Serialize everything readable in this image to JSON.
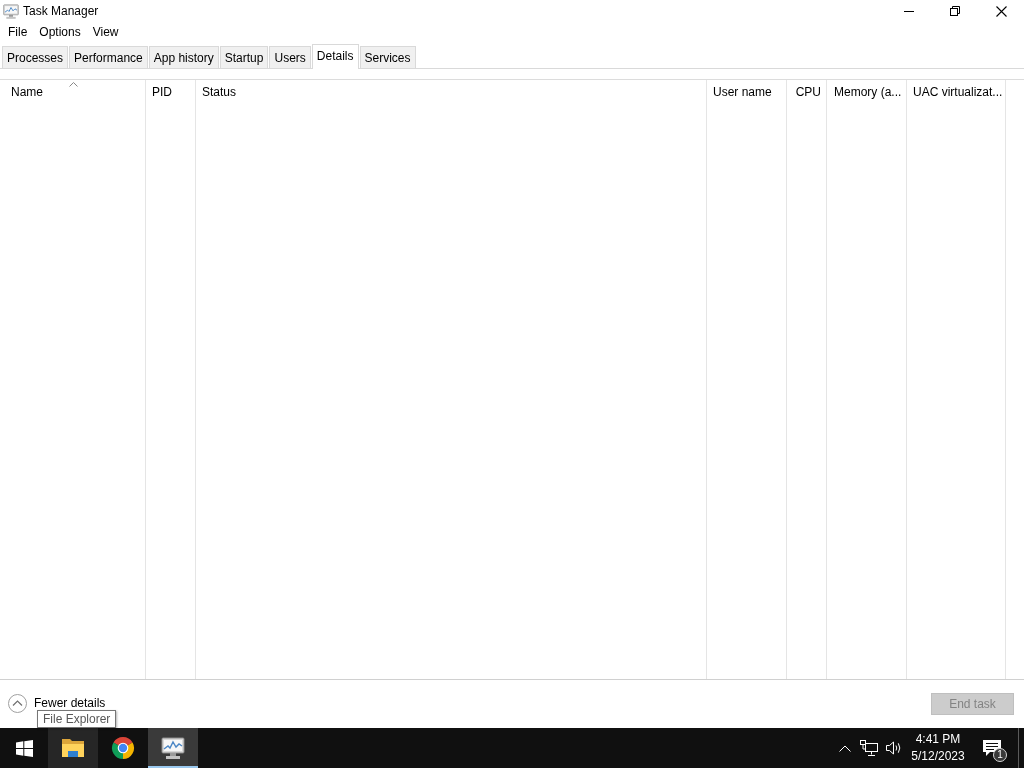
{
  "window": {
    "title": "Task Manager"
  },
  "menu": [
    "File",
    "Options",
    "View"
  ],
  "tabs": [
    {
      "label": "Processes",
      "selected": false
    },
    {
      "label": "Performance",
      "selected": false
    },
    {
      "label": "App history",
      "selected": false
    },
    {
      "label": "Startup",
      "selected": false
    },
    {
      "label": "Users",
      "selected": false
    },
    {
      "label": "Details",
      "selected": true
    },
    {
      "label": "Services",
      "selected": false
    }
  ],
  "table": {
    "columns": [
      {
        "label": "Name",
        "sorted": true,
        "kind": "text"
      },
      {
        "label": "PID",
        "sorted": false,
        "kind": "text"
      },
      {
        "label": "Status",
        "sorted": false,
        "kind": "text"
      },
      {
        "label": "User name",
        "sorted": false,
        "kind": "text"
      },
      {
        "label": "CPU",
        "sorted": false,
        "kind": "number"
      },
      {
        "label": "Memory (a...",
        "sorted": false,
        "kind": "text"
      },
      {
        "label": "UAC virtualizat...",
        "sorted": false,
        "kind": "text"
      }
    ]
  },
  "footer": {
    "toggle": "Fewer details",
    "end_task": {
      "label": "End task",
      "disabled": true
    }
  },
  "tooltip": {
    "text": "File Explorer"
  },
  "taskbar": {
    "apps": [
      {
        "kind": "folder",
        "hovered": true,
        "selected": false
      },
      {
        "kind": "browser",
        "hovered": false,
        "selected": false
      },
      {
        "kind": "monitor",
        "hovered": false,
        "selected": true
      }
    ],
    "clock": {
      "time": "4:41 PM",
      "date": "5/12/2023"
    },
    "notifications": {
      "count": "1"
    }
  }
}
